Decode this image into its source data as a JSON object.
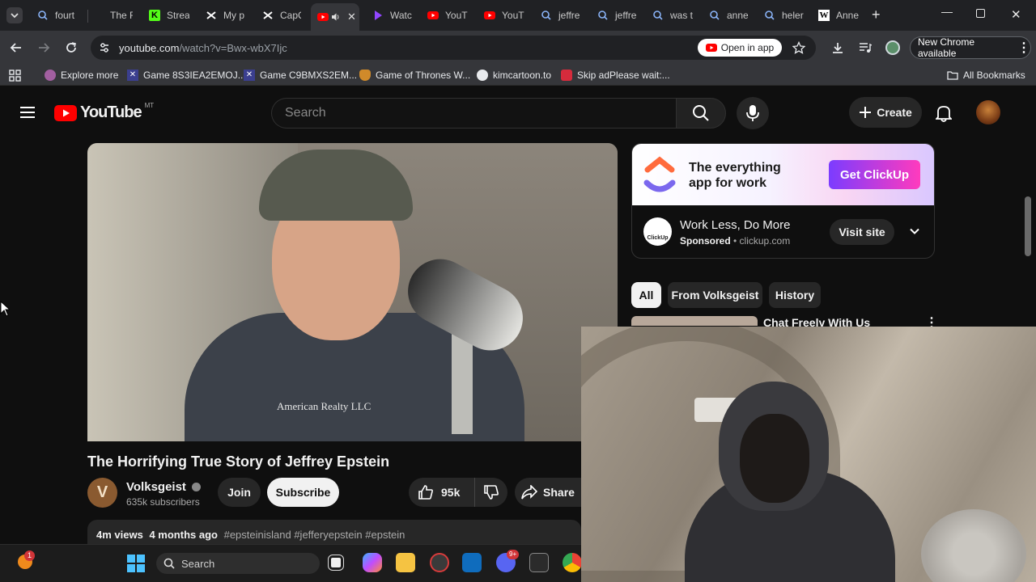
{
  "browser": {
    "tabs": [
      {
        "label": "fourt",
        "icon": "search-icon"
      },
      {
        "label": "The F",
        "icon": "page-icon"
      },
      {
        "label": "Strea",
        "icon": "kick-icon"
      },
      {
        "label": "My p",
        "icon": "capcut-icon"
      },
      {
        "label": "CapC",
        "icon": "capcut-icon"
      },
      {
        "label": "",
        "icon": "youtube-icon",
        "active": true
      },
      {
        "label": "Watc",
        "icon": "play-icon"
      },
      {
        "label": "YouT",
        "icon": "youtube-icon"
      },
      {
        "label": "YouT",
        "icon": "youtube-icon"
      },
      {
        "label": "jeffre",
        "icon": "search-icon"
      },
      {
        "label": "jeffre",
        "icon": "search-icon"
      },
      {
        "label": "was t",
        "icon": "search-icon"
      },
      {
        "label": "anne",
        "icon": "search-icon"
      },
      {
        "label": "heler",
        "icon": "search-icon"
      },
      {
        "label": "Anne",
        "icon": "wikipedia-icon"
      }
    ],
    "url_host": "youtube.com",
    "url_path": "/watch?v=Bwx-wbX7Ijc",
    "open_in_app": "Open in app",
    "new_chrome": "New Chrome available",
    "bookmarks": [
      {
        "label": "Explore more",
        "icon": "explore-icon"
      },
      {
        "label": "Game 8S3IEA2EMOJ...",
        "icon": "game-icon"
      },
      {
        "label": "Game C9BMXS2EM...",
        "icon": "game-icon"
      },
      {
        "label": "Game of Thrones W...",
        "icon": "hand-icon"
      },
      {
        "label": "kimcartoon.to",
        "icon": "globe-icon"
      },
      {
        "label": "Skip adPlease wait:...",
        "icon": "stop-sign-icon"
      }
    ],
    "all_bookmarks": "All Bookmarks"
  },
  "youtube": {
    "logo_text": "YouTube",
    "region": "MT",
    "search_placeholder": "Search",
    "create_label": "Create",
    "video": {
      "title": "The Horrifying True Story of Jeffrey Epstein",
      "shirt_text": "American Realty LLC",
      "channel": "Volksgeist",
      "channel_initial": "V",
      "subscribers": "635k subscribers",
      "join": "Join",
      "subscribe": "Subscribe",
      "likes": "95k",
      "share": "Share",
      "views": "4m views",
      "age": "4 months ago",
      "tags": "#epsteinisland #jefferyepstein #epstein"
    },
    "ad": {
      "headline": "The everything app for work",
      "cta": "Get ClickUp",
      "logo_text": "ClickUp",
      "title": "Work Less, Do More",
      "sponsored": "Sponsored",
      "domain": "clickup.com",
      "visit": "Visit site"
    },
    "chips": [
      "All",
      "From Volksgeist",
      "History"
    ],
    "rec_title": "Chat Freely With Us"
  },
  "taskbar": {
    "search_placeholder": "Search",
    "badge_count": "1",
    "discord_badge": "9+"
  },
  "colors": {
    "youtube_red": "#ff0000",
    "chrome_dark": "#202124",
    "toolbar": "#35363a"
  }
}
